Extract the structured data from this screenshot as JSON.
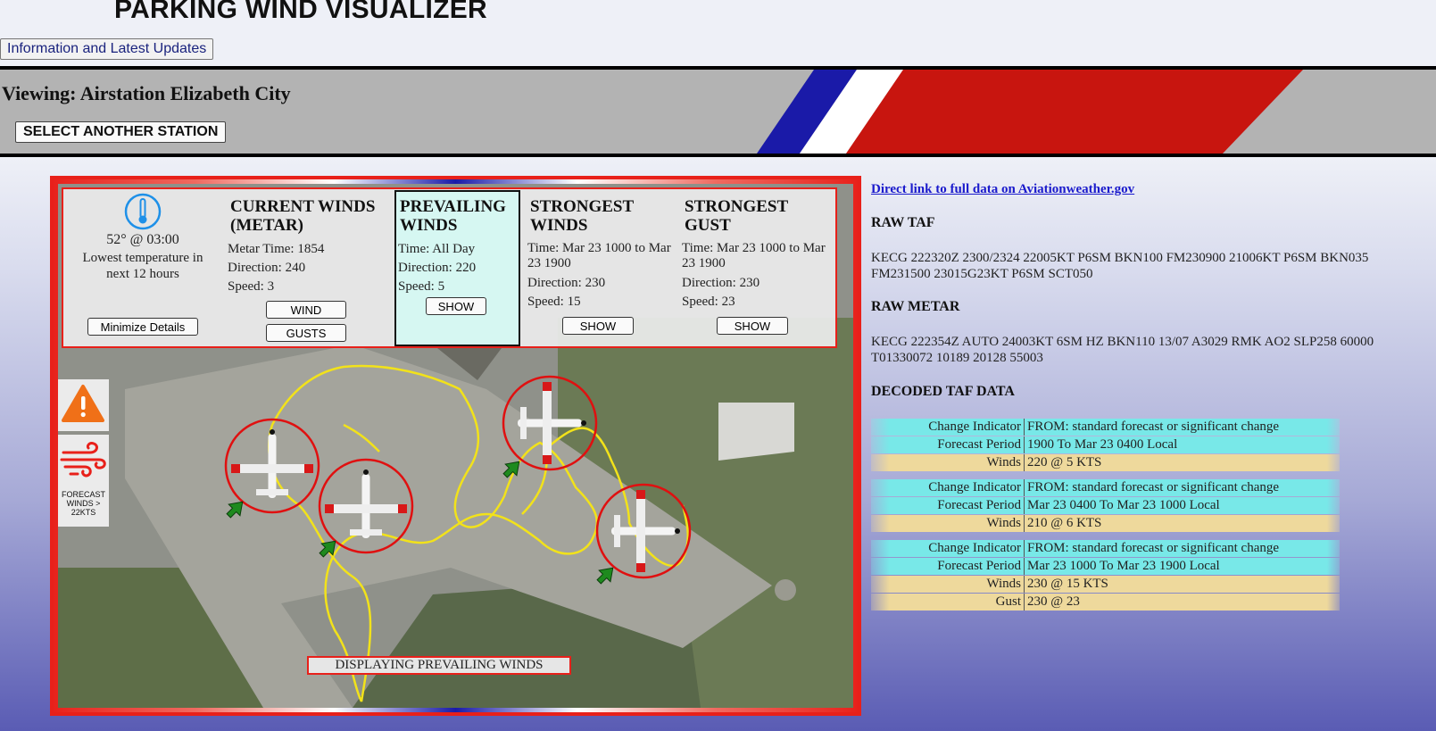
{
  "app": {
    "title": "PARKING WIND VISUALIZER",
    "info_button": "Information and Latest Updates"
  },
  "banner": {
    "station_title": "Viewing: Airstation Elizabeth City",
    "select_button": "SELECT ANOTHER STATION"
  },
  "panel": {
    "temp": {
      "value": "52° @ 03:00",
      "description": "Lowest temperature in next 12 hours",
      "minimize_button": "Minimize Details"
    },
    "current": {
      "title": "CURRENT WINDS (METAR)",
      "time": "Metar Time: 1854",
      "direction": "Direction: 240",
      "speed": "Speed: 3",
      "wind_button": "WIND",
      "gusts_button": "GUSTS"
    },
    "prevailing": {
      "title": "PREVAILING WINDS",
      "time": "Time: All Day",
      "direction": "Direction: 220",
      "speed": "Speed: 5",
      "show_button": "SHOW"
    },
    "strongest": {
      "title": "STRONGEST WINDS",
      "time": "Time: Mar 23 1000 to Mar 23 1900",
      "direction": "Direction: 230",
      "speed": "Speed: 15",
      "show_button": "SHOW"
    },
    "gust": {
      "title": "STRONGEST GUST",
      "time": "Time: Mar 23 1000 to Mar 23 1900",
      "direction": "Direction: 230",
      "speed": "Speed: 23",
      "show_button": "SHOW"
    }
  },
  "map": {
    "forecast_label": "FORECAST WINDS > 22KTS",
    "display_label": "DISPLAYING PREVAILING WINDS",
    "colors": {
      "frame_red": "#e8201a",
      "frame_blue": "#1a1aa8",
      "ring": "#e01010",
      "taxi": "#f2e21a",
      "arrow": "#1e8a1e"
    }
  },
  "right": {
    "link": "Direct link to full data on Aviationweather.gov",
    "raw_taf_title": "RAW TAF",
    "raw_taf": "KECG 222320Z 2300/2324 22005KT P6SM BKN100 FM230900 21006KT P6SM BKN035 FM231500 23015G23KT P6SM SCT050",
    "raw_metar_title": "RAW METAR",
    "raw_metar": "KECG 222354Z AUTO 24003KT 6SM HZ BKN110 13/07 A3029 RMK AO2 SLP258 60000 T01330072 10189 20128 55003",
    "decoded_title": "DECODED TAF DATA",
    "groups": [
      {
        "rows": [
          {
            "k": "Change Indicator",
            "v": "FROM: standard forecast or significant change",
            "c": "cyan"
          },
          {
            "k": "Forecast Period",
            "v": "1900 To Mar 23 0400 Local",
            "c": "cyan"
          },
          {
            "k": "Winds",
            "v": "220 @ 5 KTS",
            "c": "tan"
          }
        ]
      },
      {
        "rows": [
          {
            "k": "Change Indicator",
            "v": "FROM: standard forecast or significant change",
            "c": "cyan"
          },
          {
            "k": "Forecast Period",
            "v": "Mar 23 0400 To Mar 23 1000 Local",
            "c": "cyan"
          },
          {
            "k": "Winds",
            "v": "210 @ 6 KTS",
            "c": "tan"
          }
        ]
      },
      {
        "rows": [
          {
            "k": "Change Indicator",
            "v": "FROM: standard forecast or significant change",
            "c": "cyan"
          },
          {
            "k": "Forecast Period",
            "v": "Mar 23 1000 To Mar 23 1900 Local",
            "c": "cyan"
          },
          {
            "k": "Winds",
            "v": "230 @ 15 KTS",
            "c": "tan"
          },
          {
            "k": "Gust",
            "v": "230 @ 23",
            "c": "tan"
          }
        ]
      }
    ]
  }
}
